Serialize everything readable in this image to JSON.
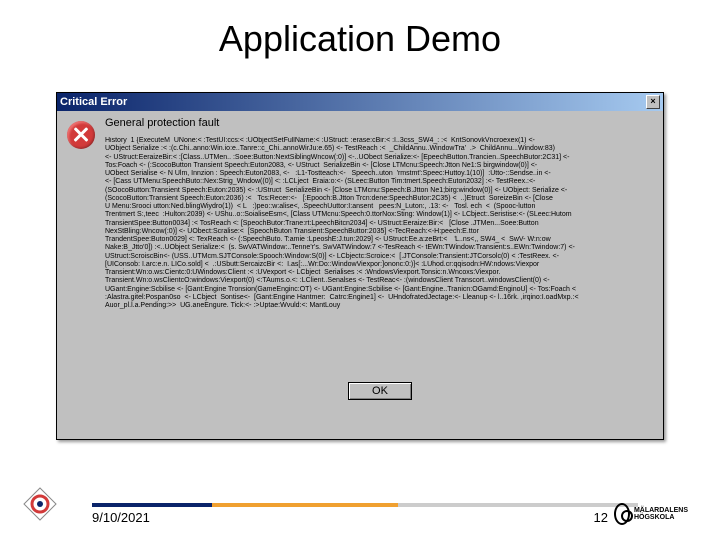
{
  "title": "Application Demo",
  "window": {
    "caption": "Critical Error",
    "close_glyph": "×",
    "message": "General protection fault",
    "ok_label": "OK",
    "trace": "History  1 {ExecuteM  UNone:< :TestUI:ccs:< :UObjectSetFullName:< :UStruct: :erase:cBir:< :I..3css_SW4_: :<  KritSonovkVncroexex(1) <-\nUObject Serialize :< :(c.Chi..anno:Win.io:e..Tanre::c_Chi..annoWirJu:e.65) <- TestReach :<  _ChildAnnu..WindowTra'  .>  ChildAnnu...Window:83)\n<- UStruct:EeraizeBir:< :[Class..UTMen.. :Soee:Button:NextSiblingWncow(:0)] <-..UObect Serialize:<- [EpeechButton.Trancien..SpeechButor:2C31] <-\nTos:Foach <- (:ScocoButton Transient Speech:Euton2083, <- UStruct  SerializeBin <- [Close LTMcnu:Speech:Jtton Ne1:S birgwindow(0)] <-\nUObect Serialise <- N Ulm, Innzion : Speech:Euton2083, <-   :L1-Tostteach:<-   Speech..uton  'rmstmt':Speec:Huttoy.1(10)]  :Utto-::Sendse..in <-\n<- [Cass UTMenu:SpeechButo::Nex:Strig_Wndow((0)] <: :LCLject  Eraia:o:<- (SLeec:Button Tim:tmert.Speech:Euton2032] :<- TestReex.:<-\n(SOocoButton:Transient Speech:Euton:2035) <- :UStruct  SerializeBin <- [Close LTMcnu:Speech:B.Jtton Ne1;birg:window(0)] <- UObject: Serialize <-\n(ScocoButton:Transient Speech:Euton:2036) :<   Tcs:Recer:<-   [:Epooch:B.Jtton Trcn:dene:SpeechButor:2C35) <  ..)Etruct  SoreizeBin <- [Close\nU Menu:Srooci utton:Ned.blingWiydro(1))  < L   :)peo::w:alise<, .SpeechUuttor:I:ansent   pees:N_Luton:, .13: <-   Tosl. ech  <  (Spooc-lutton\nTrentmert S:,teec  :Hulton:2039) <- UShu..o::SoialiseEsm<, [Class UTMcnu:Speech:0.ttorNox:Sting: Window(1)] <- LCbject:.Seristise:<- (SLeec:Hutom\nTransientSpee:Button0034] :< TosReach <: [SpeochButor:Trane:rt:LpeechBitcn2034] <- UStruct:Eeraize:Bir:<   [Close .JTMen...Soee:Button\nNexStBling:Wncow(:0)] <- UObect:Scralise:<  [SpeochButon Transient:SpeechButtor:2035] <-TecReach:<-H:peech:E.ttor\nTrandentSpee:Buton0029] <: TexReach <- (:SpeechButo. T:amie :LpeoshE:J.tun:2029] <- UStruct:Ee.a:zeBrt:<    ̒L..ns<,, SW4_ <  SwV- W:n:ow\nNake:B_Jtto'0]) :<..UObject Serialize:<  (s. SwVATWindow:..Tenne'r's. SwVATWindow:7 <-TesReach <- tEWn:TWindow:Transient:s..EWn:Twindow:7) <-\nUStruct:ScroiscBin<- (USS..UTMcm.SJTConsole:Spooch:Window:S(0)] <- LCbjectc:Scroice:<  [.JTConsole:Transient:JTCorsolc(0) < :TestReex. <-\n[UIConsob: I.arc:e.n. LICo.sold] <  .:USbutt:SercaizcBir <:  I.as[:...Wr:Do::WindowViexpor:]ononc:0:)]< :LUhod.cr:qqisodn:HW:ndows:Viexpor\nTransient:Wn:o.ws:Cientc:0:UWindows:Client :< :UVexport <- LCbject  Serialises :< :WndowsViexport.Tonsic:n.Wncoxs:Viexpor.\nTransient.Wn:o.wsClientcO:windows:Viexport(0) <:TAums.o.<: :LClient..Senalses <- TestReac<- :(windowsClient Transcort..windowsClient(0) <-\nUGant:Engine:Scbilise <- [Gant:Engine Tronsion(GameEnginc:OT) <- UGant:Engine:Scbilise <- [Gant:Engine..Tranicn:OGamd:EnginoU] <- Tos:Foach <\n:Alastra.gitel:Pospan0so  <- LCbject  Sontise<-  [Gant:Engine Hantmer:  Catrc:Engine1] <-  UHndofratedJectage:<- Lleanup <- l..16rk. ,irqino:I.oadMxp.:<\nAuor_pl.l.a.Pending:>>  UG.aneEngure. Tick:<- :>Uptae:Wvuld:<: MantLouy"
  },
  "footer": {
    "date": "9/10/2021",
    "page": "12",
    "university": "MÄLARDALENS HÖGSKOLA"
  }
}
